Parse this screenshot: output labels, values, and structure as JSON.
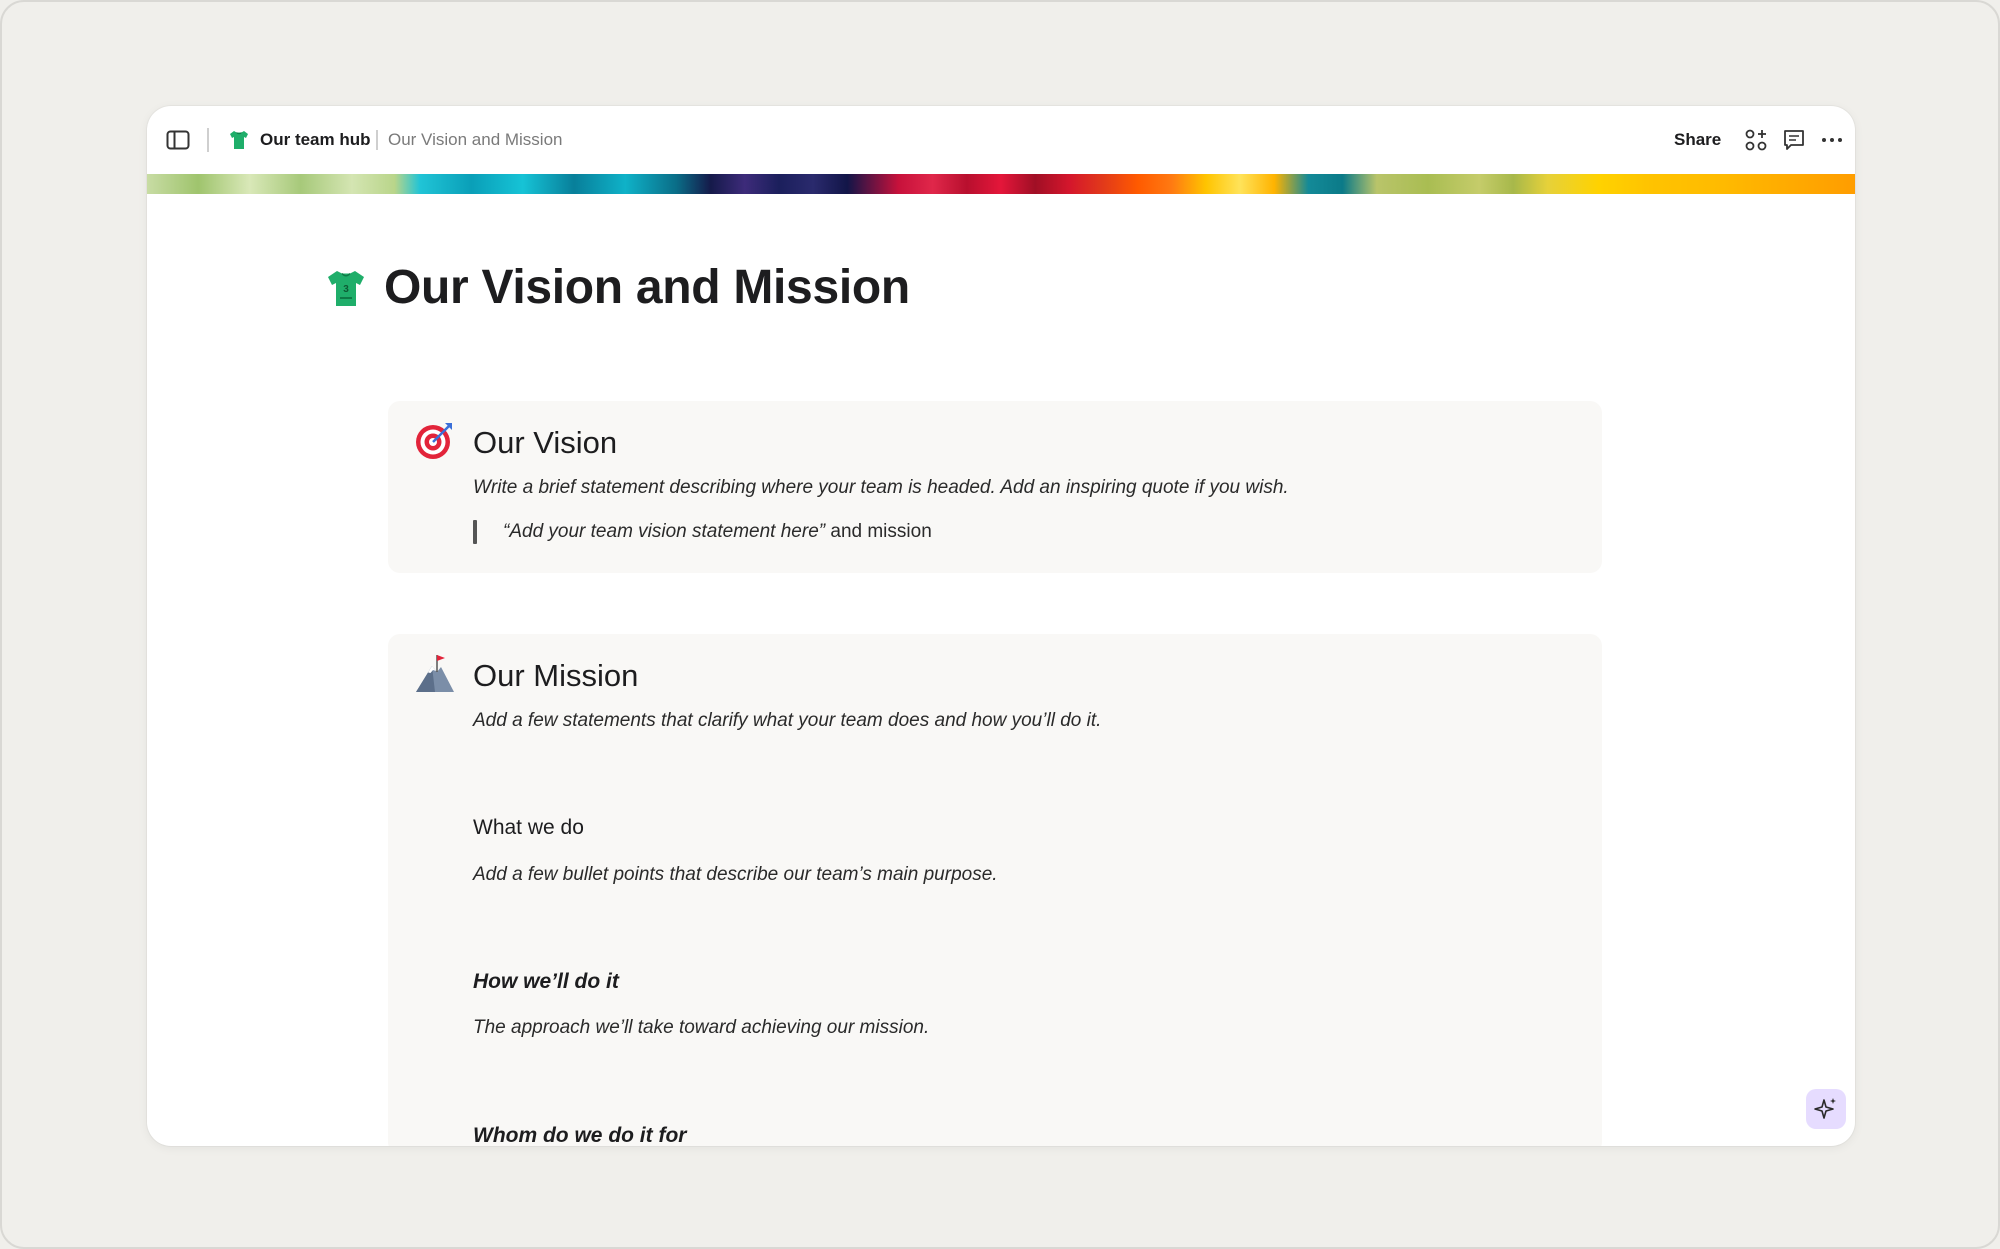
{
  "breadcrumb": {
    "hub_label": "Our team hub",
    "page_label": "Our Vision and Mission"
  },
  "toolbar": {
    "share_label": "Share"
  },
  "page": {
    "title": "Our Vision and Mission"
  },
  "vision": {
    "heading": "Our Vision",
    "description": "Write a brief statement describing where your team is headed. Add an inspiring quote if you wish.",
    "quote_italic": "“Add your team vision statement here”",
    "quote_rest": " and mission"
  },
  "mission": {
    "heading": "Our Mission",
    "description": "Add a few statements that clarify what your team does and how you’ll do it.",
    "sections": [
      {
        "title": "What we do",
        "body": "Add a few bullet points that describe our team’s main purpose."
      },
      {
        "title": "How we’ll do it",
        "body": "The approach we’ll take toward achieving our mission."
      },
      {
        "title": "Whom do we do it for",
        "body": ""
      }
    ]
  },
  "colors": {
    "background": "#f0efeb",
    "card": "#f9f8f6",
    "ai_button": "#e6dcff",
    "jersey_green": "#1fae6a"
  },
  "icons": {
    "sidebar_toggle": "sidebar-toggle-icon",
    "jersey": "jersey-icon",
    "apps": "apps-icon",
    "comments": "comment-icon",
    "more": "more-icon",
    "target": "target-icon",
    "mountain": "mountain-flag-icon",
    "ai": "sparkle-icon"
  }
}
